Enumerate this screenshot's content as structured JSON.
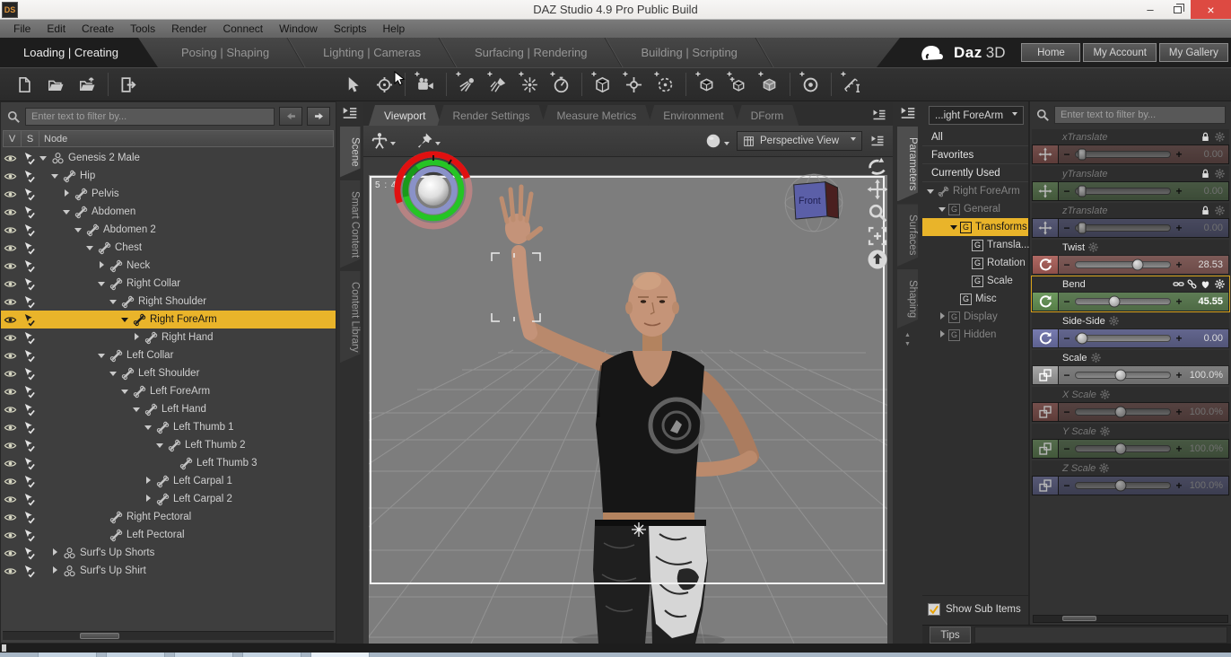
{
  "window": {
    "app_badge": "DS",
    "title": "DAZ Studio 4.9 Pro Public Build",
    "minimize_glyph": "–",
    "close_glyph": "×"
  },
  "menu": {
    "items": [
      "File",
      "Edit",
      "Create",
      "Tools",
      "Render",
      "Connect",
      "Window",
      "Scripts",
      "Help"
    ]
  },
  "activity": {
    "tabs": [
      {
        "label": "Loading | Creating",
        "active": true
      },
      {
        "label": "Posing | Shaping"
      },
      {
        "label": "Lighting | Cameras"
      },
      {
        "label": "Surfacing | Rendering"
      },
      {
        "label": "Building | Scripting"
      }
    ],
    "brand_bold": "Daz",
    "brand_light": "3D",
    "links": [
      {
        "label": "Home"
      },
      {
        "label": "My Account"
      },
      {
        "label": "My Gallery"
      }
    ]
  },
  "toolbar": {
    "plus_glyph": "+",
    "file_tools": [
      {
        "icon": "new-file"
      },
      {
        "icon": "open-folder"
      },
      {
        "icon": "save-folder"
      },
      {
        "sep": true
      },
      {
        "icon": "import"
      }
    ],
    "tools": [
      {
        "icon": "select"
      },
      {
        "icon": "universal"
      },
      {
        "sep": true
      },
      {
        "icon": "camera",
        "plus": true
      },
      {
        "sep": true
      },
      {
        "icon": "distant-light",
        "plus": true
      },
      {
        "icon": "spotlight",
        "plus": true
      },
      {
        "icon": "point-light",
        "plus": true
      },
      {
        "icon": "timer",
        "plus": true
      },
      {
        "sep": true
      },
      {
        "icon": "primitive",
        "plus": true
      },
      {
        "icon": "null",
        "plus": true
      },
      {
        "icon": "group",
        "plus": true
      },
      {
        "sep": true
      },
      {
        "icon": "node",
        "plus": true
      },
      {
        "icon": "node-add",
        "plus": true
      },
      {
        "icon": "cube",
        "plus": true
      },
      {
        "sep": true
      },
      {
        "icon": "target",
        "plus": true
      },
      {
        "sep": true
      },
      {
        "icon": "measure",
        "plus": true
      }
    ]
  },
  "scene": {
    "filter_placeholder": "Enter text to filter by...",
    "columns": {
      "v": "V",
      "s": "S",
      "node": "Node"
    },
    "tabs": [
      {
        "label": "Scene",
        "active": true
      },
      {
        "label": "Smart Content"
      },
      {
        "label": "Content Library"
      }
    ],
    "tree": [
      {
        "label": "Genesis 2 Male",
        "indent": 0,
        "arrow": "down",
        "icon": "person"
      },
      {
        "label": "Hip",
        "indent": 1,
        "arrow": "down",
        "icon": "bone"
      },
      {
        "label": "Pelvis",
        "indent": 2,
        "arrow": "right",
        "icon": "bone"
      },
      {
        "label": "Abdomen",
        "indent": 2,
        "arrow": "down",
        "icon": "bone"
      },
      {
        "label": "Abdomen 2",
        "indent": 3,
        "arrow": "down",
        "icon": "bone"
      },
      {
        "label": "Chest",
        "indent": 4,
        "arrow": "down",
        "icon": "bone"
      },
      {
        "label": "Neck",
        "indent": 5,
        "arrow": "right",
        "icon": "bone"
      },
      {
        "label": "Right Collar",
        "indent": 5,
        "arrow": "down",
        "icon": "bone"
      },
      {
        "label": "Right Shoulder",
        "indent": 6,
        "arrow": "down",
        "icon": "bone"
      },
      {
        "label": "Right ForeArm",
        "indent": 7,
        "arrow": "down",
        "icon": "bone",
        "selected": true
      },
      {
        "label": "Right Hand",
        "indent": 8,
        "arrow": "right",
        "icon": "bone"
      },
      {
        "label": "Left Collar",
        "indent": 5,
        "arrow": "down",
        "icon": "bone"
      },
      {
        "label": "Left Shoulder",
        "indent": 6,
        "arrow": "down",
        "icon": "bone"
      },
      {
        "label": "Left ForeArm",
        "indent": 7,
        "arrow": "down",
        "icon": "bone"
      },
      {
        "label": "Left Hand",
        "indent": 8,
        "arrow": "down",
        "icon": "bone"
      },
      {
        "label": "Left Thumb 1",
        "indent": 9,
        "arrow": "down",
        "icon": "bone"
      },
      {
        "label": "Left Thumb 2",
        "indent": 10,
        "arrow": "down",
        "icon": "bone"
      },
      {
        "label": "Left Thumb 3",
        "indent": 11,
        "icon": "bone"
      },
      {
        "label": "Left Carpal 1",
        "indent": 9,
        "arrow": "right",
        "icon": "bone"
      },
      {
        "label": "Left Carpal 2",
        "indent": 9,
        "arrow": "right",
        "icon": "bone"
      },
      {
        "label": "Right Pectoral",
        "indent": 5,
        "icon": "bone"
      },
      {
        "label": "Left Pectoral",
        "indent": 5,
        "icon": "bone"
      },
      {
        "label": "Surf's Up Shorts",
        "indent": 1,
        "arrow": "right",
        "icon": "person"
      },
      {
        "label": "Surf's Up Shirt",
        "indent": 1,
        "arrow": "right",
        "icon": "person"
      }
    ]
  },
  "viewport": {
    "tabs": [
      {
        "label": "Viewport",
        "active": true
      },
      {
        "label": "Render Settings"
      },
      {
        "label": "Measure Metrics"
      },
      {
        "label": "Environment"
      },
      {
        "label": "DForm"
      }
    ],
    "camera_selector": "Perspective View",
    "aspect_ratio_label": "5 : 4",
    "orientation_cube_label": "Front"
  },
  "parameters": {
    "tabs": [
      {
        "label": "Parameters",
        "active": true
      },
      {
        "label": "Surfaces"
      },
      {
        "label": "Shaping"
      }
    ],
    "node_selector": "...ight ForeArm",
    "gbox_label": "G",
    "filter_placeholder": "Enter text to filter by...",
    "minus_glyph": "−",
    "plus_glyph": "+",
    "show_sub_items_label": "Show Sub Items",
    "tips_label": "Tips",
    "nav": [
      {
        "label": "All",
        "plain": true
      },
      {
        "label": "Favorites",
        "plain": true
      },
      {
        "label": "Currently Used",
        "plain": true
      },
      {
        "label": "Right ForeArm",
        "indent": 0,
        "arrow": "down",
        "icon": "bone",
        "dim": true
      },
      {
        "label": "General",
        "indent": 1,
        "arrow": "down",
        "gbox": true,
        "dim": true
      },
      {
        "label": "Transforms",
        "indent": 2,
        "arrow": "down",
        "gbox": true,
        "selected": true
      },
      {
        "label": "Transla...",
        "indent": 3,
        "gbox": true
      },
      {
        "label": "Rotation",
        "indent": 3,
        "gbox": true
      },
      {
        "label": "Scale",
        "indent": 3,
        "gbox": true
      },
      {
        "label": "Misc",
        "indent": 2,
        "gbox": true
      },
      {
        "label": "Display",
        "indent": 1,
        "arrow": "right",
        "gbox": true,
        "dim": true
      },
      {
        "label": "Hidden",
        "indent": 1,
        "arrow": "right",
        "gbox": true,
        "dim": true
      }
    ],
    "sliders": [
      {
        "label": "xTranslate",
        "value": "0.00",
        "pos": 7,
        "red": true,
        "kind": "move",
        "dim": true,
        "locked": true
      },
      {
        "label": "yTranslate",
        "value": "0.00",
        "pos": 7,
        "green": true,
        "kind": "move",
        "dim": true,
        "locked": true
      },
      {
        "label": "zTranslate",
        "value": "0.00",
        "pos": 7,
        "blue": true,
        "kind": "move",
        "dim": true,
        "locked": true
      },
      {
        "label": "Twist",
        "value": "28.53",
        "pos": 66,
        "red": true,
        "kind": "rotate"
      },
      {
        "label": "Bend",
        "value": "45.55",
        "pos": 41,
        "green": true,
        "kind": "rotate",
        "selected": true
      },
      {
        "label": "Side-Side",
        "value": "0.00",
        "pos": 7,
        "blue": true,
        "kind": "rotate"
      },
      {
        "label": "Scale",
        "value": "100.0%",
        "pos": 48,
        "gray": true,
        "kind": "scale"
      },
      {
        "label": "X Scale",
        "value": "100.0%",
        "pos": 48,
        "red": true,
        "kind": "scale",
        "dim": true
      },
      {
        "label": "Y Scale",
        "value": "100.0%",
        "pos": 48,
        "green": true,
        "kind": "scale",
        "dim": true
      },
      {
        "label": "Z Scale",
        "value": "100.0%",
        "pos": 48,
        "blue": true,
        "kind": "scale",
        "dim": true
      }
    ]
  },
  "colors": {
    "selection": "#e9b42a",
    "close_button": "#dd4a42",
    "axis_x": "#a35f5a",
    "axis_y": "#5f9158",
    "axis_z": "#6d6f9e"
  }
}
